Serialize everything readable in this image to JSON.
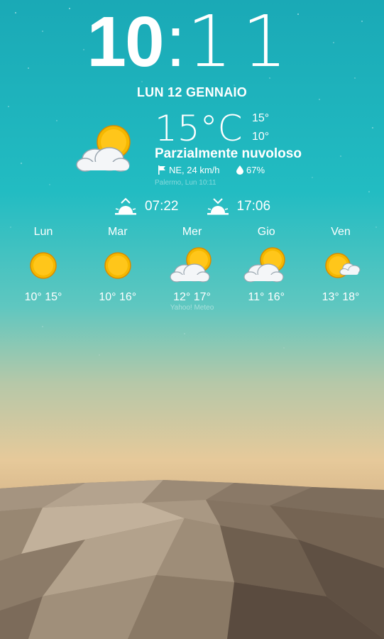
{
  "clock": {
    "hours": "10",
    "separator": ":",
    "minutes": "11"
  },
  "date": "LUN 12 GENNAIO",
  "current": {
    "temp": "15°C",
    "high": "15°",
    "low": "10°",
    "condition": "Parzialmente nuvoloso",
    "wind": "NE, 24 km/h",
    "humidity": "67%",
    "location": "Palermo, Lun 10:11",
    "icon": "partly-cloudy-icon"
  },
  "sun": {
    "sunrise": "07:22",
    "sunset": "17:06"
  },
  "forecast": [
    {
      "day": "Lun",
      "temps": "10° 15°",
      "icon": "sunny-icon"
    },
    {
      "day": "Mar",
      "temps": "10° 16°",
      "icon": "sunny-icon"
    },
    {
      "day": "Mer",
      "temps": "12° 17°",
      "icon": "partly-cloudy-icon"
    },
    {
      "day": "Gio",
      "temps": "11° 16°",
      "icon": "partly-cloudy-icon"
    },
    {
      "day": "Ven",
      "temps": "13° 18°",
      "icon": "mostly-sunny-icon"
    }
  ],
  "provider": "Yahoo! Meteo",
  "colors": {
    "sun": "#f5b800",
    "sky_top": "#1aa9b6",
    "sand": "#9c8b78"
  }
}
